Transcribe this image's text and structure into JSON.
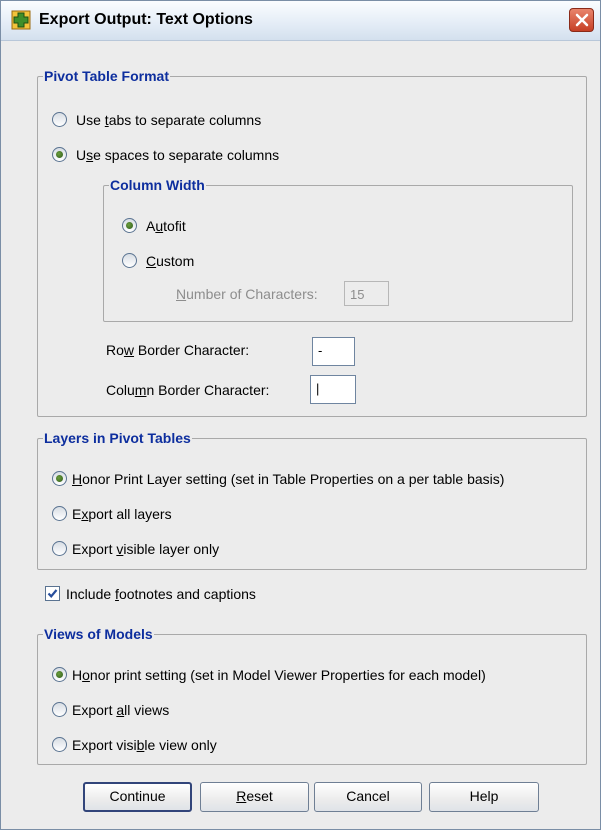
{
  "window": {
    "title": "Export Output: Text Options",
    "app_icon": "plus-cross-icon",
    "close_icon": "close-icon"
  },
  "pivot_table_format": {
    "legend": "Pivot Table Format",
    "options": [
      {
        "pre": "Use ",
        "key": "t",
        "post": "abs to separate columns",
        "selected": false
      },
      {
        "pre": "U",
        "key": "s",
        "post": "e spaces to separate columns",
        "selected": true
      }
    ],
    "column_width": {
      "legend": "Column Width",
      "options": [
        {
          "pre": "A",
          "key": "u",
          "post": "tofit",
          "selected": true
        },
        {
          "pre": "",
          "key": "C",
          "post": "ustom",
          "selected": false
        }
      ],
      "num_chars_label_pre": "",
      "num_chars_label_key": "N",
      "num_chars_label_post": "umber of Characters:",
      "num_chars_value": "15"
    },
    "row_border": {
      "pre": "Ro",
      "key": "w",
      "post": " Border Character:",
      "value": "-"
    },
    "col_border": {
      "pre": "Colu",
      "key": "m",
      "post": "n Border Character:",
      "value": "|"
    }
  },
  "layers": {
    "legend": "Layers in Pivot Tables",
    "options": [
      {
        "pre": "",
        "key": "H",
        "post": "onor Print Layer setting (set in Table Properties on a per table basis)",
        "selected": true
      },
      {
        "pre": "E",
        "key": "x",
        "post": "port all layers",
        "selected": false
      },
      {
        "pre": "Export ",
        "key": "v",
        "post": "isible layer only",
        "selected": false
      }
    ]
  },
  "footnotes": {
    "pre": "Include ",
    "key": "f",
    "post": "ootnotes and captions",
    "checked": true
  },
  "views": {
    "legend": "Views of Models",
    "options": [
      {
        "pre": "H",
        "key": "o",
        "post": "nor print setting (set in Model Viewer Properties for each model)",
        "selected": true
      },
      {
        "pre": "Export ",
        "key": "a",
        "post": "ll views",
        "selected": false
      },
      {
        "pre": "Export visi",
        "key": "b",
        "post": "le view only",
        "selected": false
      }
    ]
  },
  "buttons": {
    "continue": "Continue",
    "reset_key": "R",
    "reset_rest": "eset",
    "cancel": "Cancel",
    "help": "Help"
  }
}
